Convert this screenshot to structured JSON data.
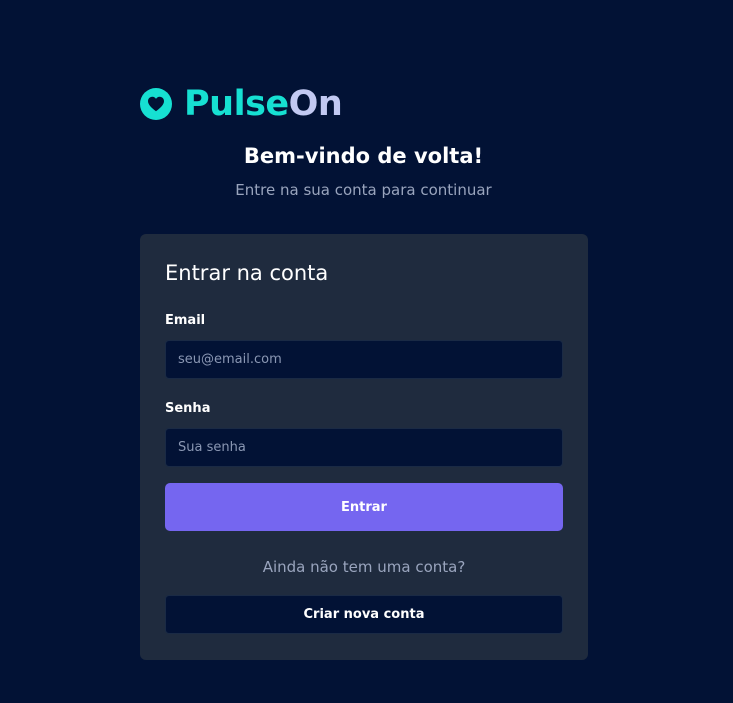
{
  "brand": {
    "name_part1": "Pulse",
    "name_part2": "On",
    "icon": "heart-icon",
    "accent_color": "#16e0d2",
    "secondary_color": "#c2c9f2"
  },
  "header": {
    "welcome": "Bem-vindo de volta!",
    "subtitle": "Entre na sua conta para continuar"
  },
  "login_card": {
    "title": "Entrar na conta",
    "email": {
      "label": "Email",
      "value": "",
      "placeholder": "seu@email.com"
    },
    "password": {
      "label": "Senha",
      "value": "",
      "placeholder": "Sua senha"
    },
    "submit_label": "Entrar",
    "signup_prompt": "Ainda não tem uma conta?",
    "signup_label": "Criar nova conta"
  },
  "colors": {
    "background": "#021235",
    "card": "#1f2b3e",
    "primary_button": "#7566f0"
  }
}
